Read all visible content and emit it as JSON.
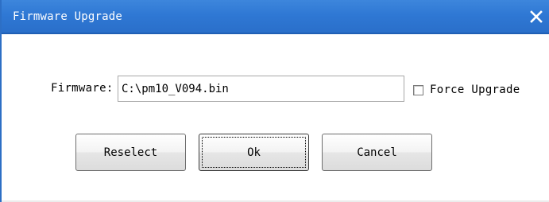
{
  "window": {
    "title": "Firmware Upgrade",
    "close_icon": "close-icon",
    "accent_color": "#2f78d4"
  },
  "form": {
    "firmware_label": "Firmware:",
    "firmware_value": "C:\\pm10_V094.bin",
    "force_upgrade_label": "Force Upgrade",
    "force_upgrade_checked": false
  },
  "buttons": {
    "reselect_label": "Reselect",
    "ok_label": "Ok",
    "cancel_label": "Cancel"
  }
}
